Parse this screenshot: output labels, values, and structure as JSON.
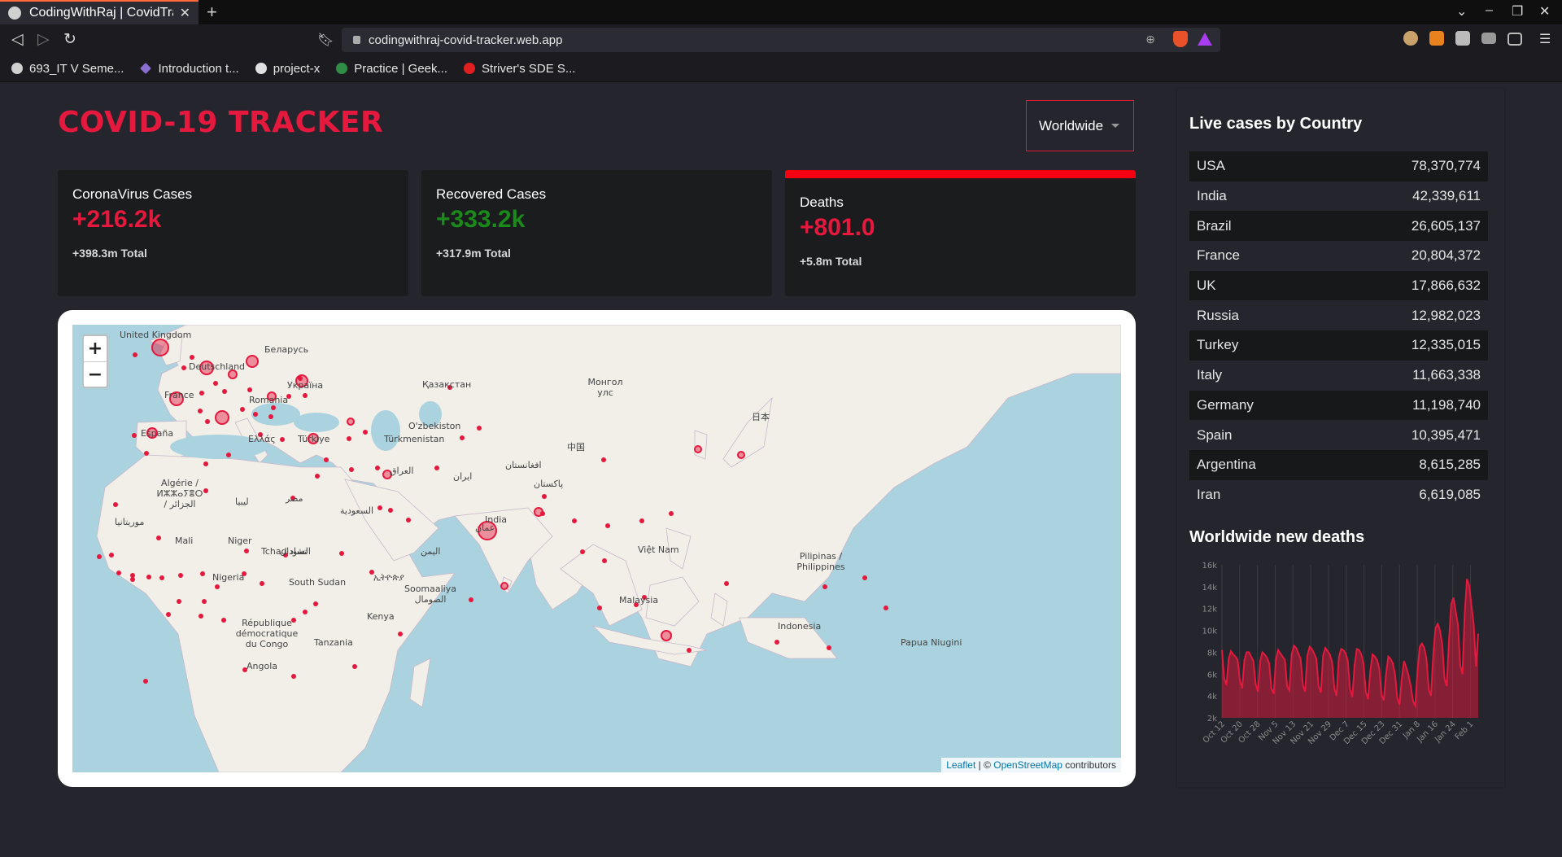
{
  "browser": {
    "tab_title": "CodingWithRaj | CovidTrac",
    "url": "codingwithraj-covid-tracker.web.app",
    "bookmarks": [
      {
        "label": "693_IT V Seme...",
        "color": "#d0d0d0"
      },
      {
        "label": "Introduction t...",
        "color": "#8a6fd1"
      },
      {
        "label": "project-x",
        "color": "#e0e0e0"
      },
      {
        "label": "Practice | Geek...",
        "color": "#2f8d46"
      },
      {
        "label": "Striver's SDE S...",
        "color": "#e02020"
      }
    ]
  },
  "app": {
    "title": "COVID-19 TRACKER",
    "country_select": "Worldwide"
  },
  "cards": [
    {
      "title": "CoronaVirus Cases",
      "value": "+216.2k",
      "total": "+398.3m Total",
      "color": "#e5183d",
      "selected": false
    },
    {
      "title": "Recovered Cases",
      "value": "+333.2k",
      "total": "+317.9m Total",
      "color": "#1a8a1a",
      "selected": false
    },
    {
      "title": "Deaths",
      "value": "+801.0",
      "total": "+5.8m Total",
      "color": "#e5183d",
      "selected": true
    }
  ],
  "map": {
    "zoom_in": "+",
    "zoom_out": "−",
    "attribution_leaflet": "Leaflet",
    "attribution_mid": " | © ",
    "attribution_osm": "OpenStreetMap",
    "attribution_end": " contributors",
    "labels": [
      "United Kingdom",
      "Deutschland",
      "France",
      "España",
      "Беларусь",
      "Україна",
      "Romania",
      "Ελλάς",
      "Türkiye",
      "Қазақстан",
      "O'zbekiston",
      "Türkmenistan",
      "Монгол улс",
      "中国",
      "日本",
      "India",
      "Algérie / ⵍⵣⵣⴰⵢⴻⵔ / الجزائر",
      "ليبيا",
      "مصر",
      "السعودية",
      "Mali",
      "Niger",
      "Tchad تشاد",
      "السودان",
      "Nigeria",
      "South Sudan",
      "Soomaaliya الصومال",
      "Kenya",
      "République démocratique du Congo",
      "Tanzania",
      "Angola",
      "Việt Nam",
      "Pilipinas / Philippines",
      "Malaysia",
      "Indonesia",
      "Papua Niugini",
      "افغانستان",
      "ایران",
      "العراق",
      "پاکستان",
      "عمان",
      "موريتانيا",
      "اليمن",
      "ኢትዮጵያ"
    ]
  },
  "live_cases": {
    "title": "Live cases by Country",
    "rows": [
      {
        "country": "USA",
        "cases": "78,370,774"
      },
      {
        "country": "India",
        "cases": "42,339,611"
      },
      {
        "country": "Brazil",
        "cases": "26,605,137"
      },
      {
        "country": "France",
        "cases": "20,804,372"
      },
      {
        "country": "UK",
        "cases": "17,866,632"
      },
      {
        "country": "Russia",
        "cases": "12,982,023"
      },
      {
        "country": "Turkey",
        "cases": "12,335,015"
      },
      {
        "country": "Italy",
        "cases": "11,663,338"
      },
      {
        "country": "Germany",
        "cases": "11,198,740"
      },
      {
        "country": "Spain",
        "cases": "10,395,471"
      },
      {
        "country": "Argentina",
        "cases": "8,615,285"
      },
      {
        "country": "Iran",
        "cases": "6,619,085"
      }
    ]
  },
  "chart_title": "Worldwide new deaths",
  "chart_data": {
    "type": "area",
    "title": "Worldwide new deaths",
    "y_ticks": [
      "2k",
      "4k",
      "6k",
      "8k",
      "10k",
      "12k",
      "14k",
      "16k"
    ],
    "ylim": [
      2000,
      16000
    ],
    "x_ticks": [
      "Oct 12",
      "Oct 20",
      "Oct 28",
      "Nov 5",
      "Nov 13",
      "Nov 21",
      "Nov 29",
      "Dec 7",
      "Dec 15",
      "Dec 23",
      "Dec 31",
      "Jan 8",
      "Jan 16",
      "Jan 24",
      "Feb 1"
    ],
    "color": "#e5183d",
    "values": [
      8200,
      5600,
      5000,
      7400,
      8100,
      7800,
      7600,
      7300,
      5400,
      4700,
      7300,
      8000,
      8000,
      7600,
      7200,
      5100,
      4400,
      7200,
      8000,
      7800,
      7500,
      7000,
      4700,
      4200,
      7300,
      8200,
      7900,
      7600,
      7300,
      4900,
      4500,
      7800,
      8600,
      8400,
      7900,
      7400,
      5000,
      4400,
      7700,
      8500,
      8300,
      7900,
      7400,
      4900,
      4300,
      7700,
      8400,
      8100,
      7800,
      7100,
      4700,
      4000,
      7500,
      8300,
      8200,
      7900,
      7200,
      4600,
      3900,
      6800,
      8300,
      8200,
      7800,
      6900,
      4400,
      3700,
      6300,
      7800,
      7600,
      7300,
      6500,
      4100,
      3600,
      6000,
      7600,
      7400,
      7000,
      6000,
      3800,
      3200,
      5600,
      7200,
      6600,
      5900,
      4900,
      3500,
      3100,
      6300,
      8500,
      8800,
      8400,
      7400,
      4600,
      4000,
      7700,
      10200,
      10600,
      10000,
      8700,
      5600,
      4900,
      9100,
      12400,
      13000,
      11700,
      10500,
      6800,
      6000,
      11500,
      14700,
      14100,
      12300,
      10500,
      6700,
      9700
    ]
  }
}
